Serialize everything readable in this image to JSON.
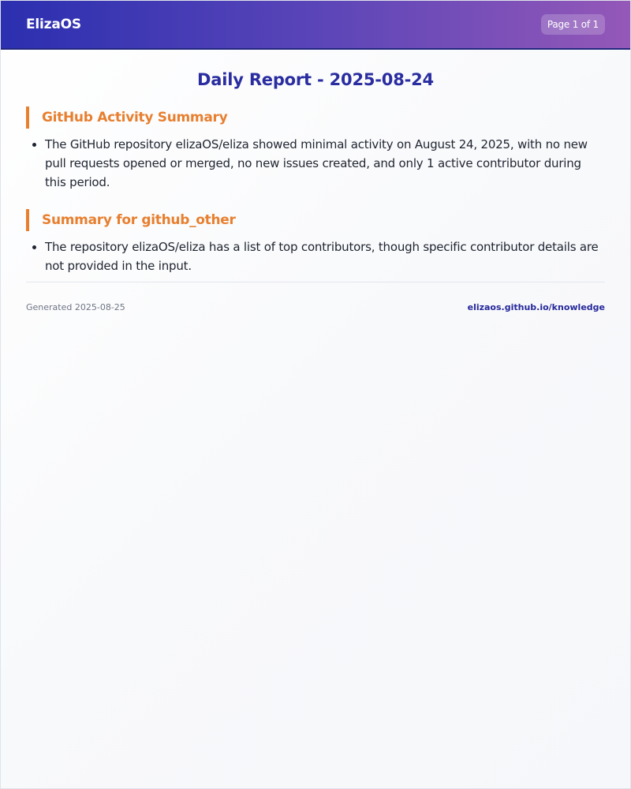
{
  "header": {
    "brand": "ElizaOS",
    "page_indicator": "Page 1 of 1"
  },
  "report": {
    "title": "Daily Report - 2025-08-24",
    "sections": [
      {
        "heading": "GitHub Activity Summary",
        "items": [
          "The GitHub repository elizaOS/eliza showed minimal activity on August 24, 2025, with no new pull requests opened or merged, no new issues created, and only 1 active contributor during this period."
        ]
      },
      {
        "heading": "Summary for github_other",
        "items": [
          "The repository elizaOS/eliza has a list of top contributors, though specific contributor details are not provided in the input."
        ]
      }
    ]
  },
  "footer": {
    "generated": "Generated 2025-08-25",
    "link": "elizaos.github.io/knowledge"
  },
  "colors": {
    "header_gradient_start": "#2b2fb0",
    "header_gradient_end": "#9458b8",
    "title": "#2a2da0",
    "section_accent": "#e77f2f",
    "link": "#25289a"
  }
}
